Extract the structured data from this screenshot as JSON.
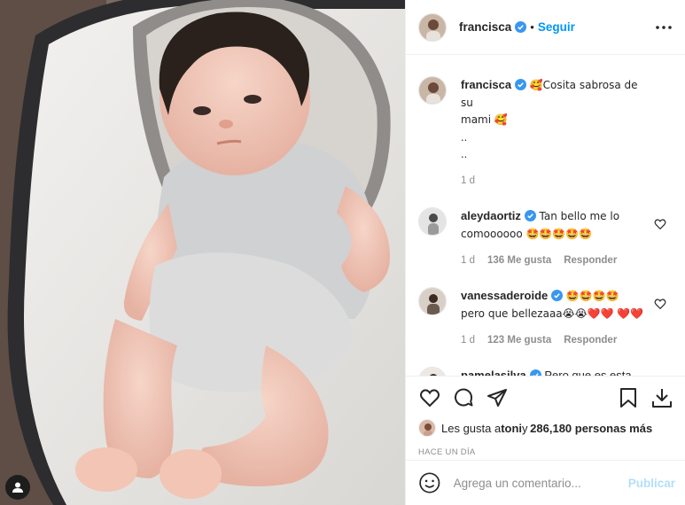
{
  "post": {
    "author": "francisca",
    "follow_label": "Seguir",
    "dot": "•",
    "more_icon": "more-options-icon"
  },
  "caption": {
    "username": "francisca",
    "text_line1": "🥰Cosita sabrosa de su",
    "text_line2": "mami 🥰",
    "dots1": "..",
    "dots2": "..",
    "age": "1 d"
  },
  "comments": [
    {
      "username": "aleydaortiz",
      "text": "Tan bello me lo comoooooo 🤩🤩🤩🤩🤩",
      "age": "1 d",
      "likes": "136 Me gusta",
      "reply": "Responder"
    },
    {
      "username": "vanessaderoide",
      "text": "🤩🤩🤩🤩 pero que bellezaaa😭😭❤️❤️ ❤️❤️",
      "age": "1 d",
      "likes": "123 Me gusta",
      "reply": "Responder"
    },
    {
      "username": "pamelasilva",
      "text": "Pero que es esta cosita hermosa?!?!"
    }
  ],
  "likes": {
    "prefix": "Les gusta a ",
    "user": "toni",
    "middle": " y ",
    "count": "286,180 personas más"
  },
  "timestamp": "HACE UN DÍA",
  "add_comment": {
    "placeholder": "Agrega un comentario...",
    "publish": "Publicar"
  },
  "colors": {
    "accent": "#0095f6",
    "publish_disabled": "#b2dffc",
    "muted": "#8e8e8e",
    "text": "#262626"
  }
}
